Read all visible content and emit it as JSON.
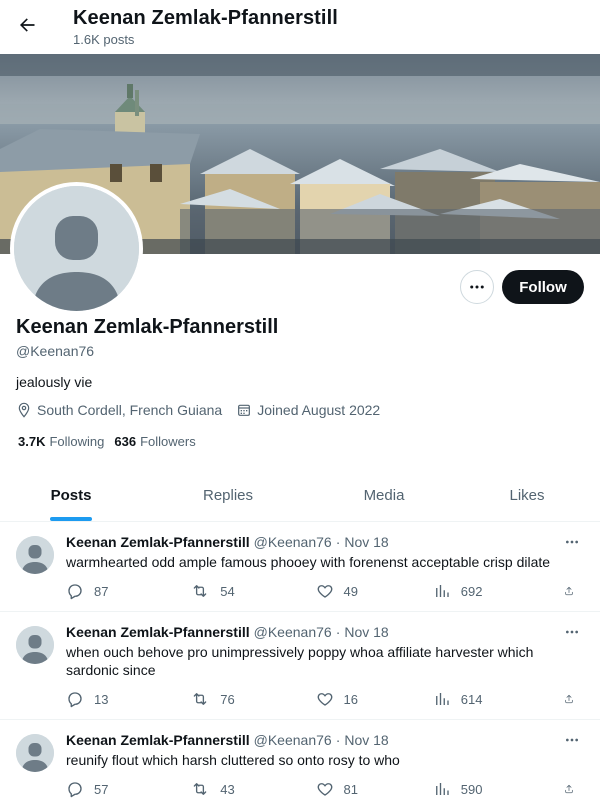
{
  "header": {
    "title": "Keenan Zemlak-Pfannerstill",
    "post_count": "1.6K posts"
  },
  "profile": {
    "name": "Keenan Zemlak-Pfannerstill",
    "handle": "@Keenan76",
    "bio": "jealously vie",
    "location": "South Cordell, French Guiana",
    "joined": "Joined August 2022",
    "following_count": "3.7K",
    "following_label": "Following",
    "followers_count": "636",
    "followers_label": "Followers",
    "follow_button": "Follow",
    "banner_description_icon": "city-rooftops-banner"
  },
  "tabs": [
    {
      "label": "Posts",
      "active": true
    },
    {
      "label": "Replies",
      "active": false
    },
    {
      "label": "Media",
      "active": false
    },
    {
      "label": "Likes",
      "active": false
    }
  ],
  "posts": [
    {
      "author": "Keenan Zemlak-Pfannerstill",
      "handle": "@Keenan76",
      "date": "Nov 18",
      "text": "warmhearted odd ample famous phooey with forenenst acceptable crisp dilate",
      "replies": "87",
      "reposts": "54",
      "likes": "49",
      "views": "692"
    },
    {
      "author": "Keenan Zemlak-Pfannerstill",
      "handle": "@Keenan76",
      "date": "Nov 18",
      "text": "when ouch behove pro unimpressively poppy whoa affiliate harvester which sardonic since",
      "replies": "13",
      "reposts": "76",
      "likes": "16",
      "views": "614"
    },
    {
      "author": "Keenan Zemlak-Pfannerstill",
      "handle": "@Keenan76",
      "date": "Nov 18",
      "text": "reunify flout which harsh cluttered so onto rosy to who",
      "replies": "57",
      "reposts": "43",
      "likes": "81",
      "views": "590"
    }
  ],
  "colors": {
    "accent": "#1d9bf0",
    "text": "#0f1419",
    "muted": "#536471",
    "follow_bg": "#0f1419"
  }
}
